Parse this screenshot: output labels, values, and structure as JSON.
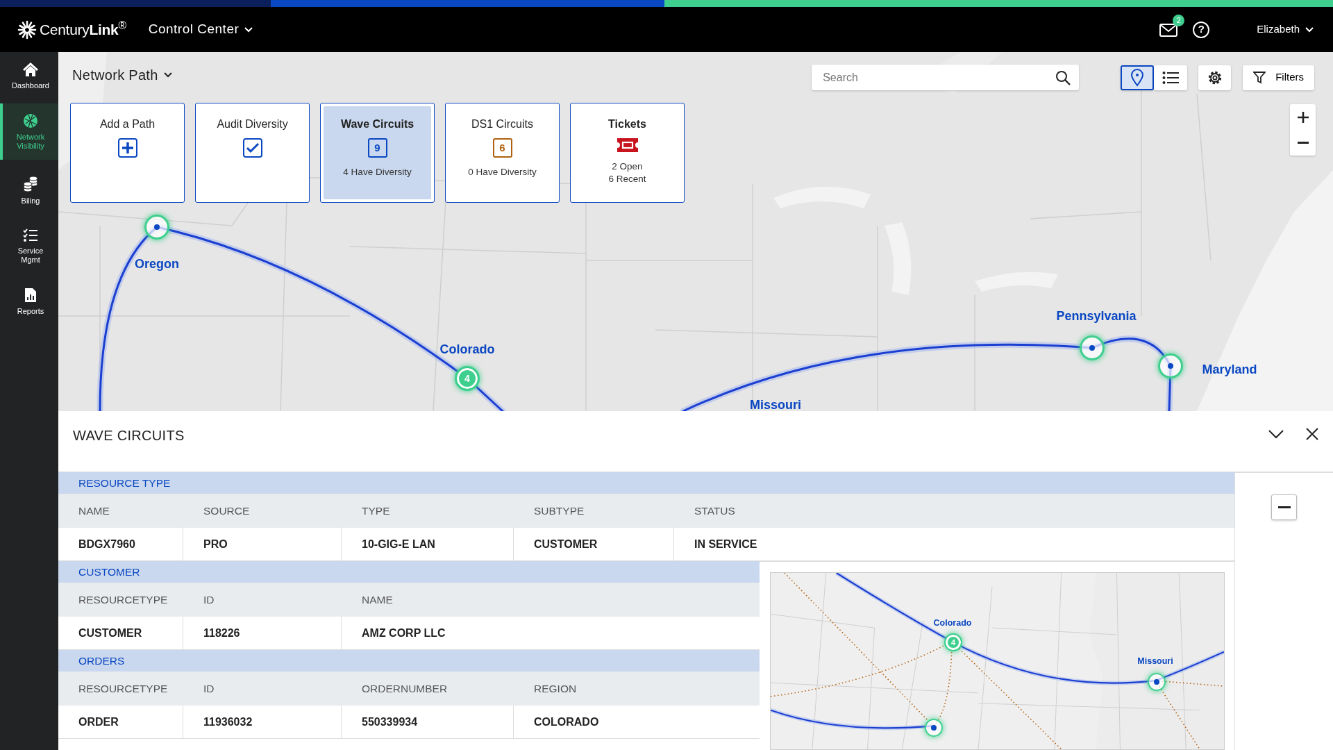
{
  "top_bar": {
    "brand": "Century**Link**$^{®}$",
    "app_menu": "Control Center",
    "help": "?",
    "notifications": "2",
    "user": "Elizabeth"
  },
  "sidebar": {
    "items": [
      {
        "label": "Dashboard",
        "kind": "home",
        "selected": false
      },
      {
        "label": "Network Visibility",
        "kind": "globe",
        "selected": true
      },
      {
        "label": "Biling",
        "kind": "coins",
        "selected": false
      },
      {
        "label": "Service Mgmt",
        "kind": "checklist",
        "selected": false
      },
      {
        "label": "Reports",
        "kind": "report",
        "selected": false
      }
    ]
  },
  "page_title": "Network Path",
  "search": {
    "placeholder": "Search"
  },
  "view_toggle": [
    {
      "kind": "map",
      "selected": true
    },
    {
      "kind": "list",
      "selected": false
    }
  ],
  "filters_button": "Filters",
  "tiles": [
    {
      "title": "Add a Path",
      "kind": "add",
      "selected": false
    },
    {
      "title": "Audit Diversity",
      "kind": "audit",
      "selected": false
    },
    {
      "title": "Wave Circuits",
      "kind": "count",
      "count": "9",
      "color": "#0a47c2",
      "selected": true,
      "lines": [
        "4 Have Diversity"
      ]
    },
    {
      "title": "DS1 Circuits",
      "kind": "count",
      "count": "6",
      "color": "#b0620f",
      "selected": false,
      "lines": [
        "0 Have Diversity"
      ]
    },
    {
      "title": "Tickets",
      "kind": "ticket",
      "selected": false,
      "lines": [
        "2 Open",
        "6 Recent"
      ]
    }
  ],
  "map": {
    "labels": [
      "Oregon",
      "Colorado",
      "Missouri",
      "Pennsylvania",
      "Maryland"
    ],
    "markers": [
      {
        "kind": "point"
      },
      {
        "kind": "cluster",
        "count": "4"
      },
      {
        "kind": "point"
      },
      {
        "kind": "point"
      }
    ]
  },
  "panel": {
    "title": "WAVE CIRCUITS",
    "sections": [
      {
        "title": "RESOURCE TYPE",
        "columns": [
          "NAME",
          "SOURCE",
          "TYPE",
          "SUBTYPE",
          "STATUS"
        ],
        "rows": [
          [
            "BDGX7960",
            "PRO",
            "10-GIG-E LAN",
            "CUSTOMER",
            "IN SERVICE"
          ]
        ]
      },
      {
        "title": "CUSTOMER",
        "columns": [
          "RESOURCETYPE",
          "ID",
          "NAME"
        ],
        "rows": [
          [
            "CUSTOMER",
            "118226",
            "AMZ CORP LLC"
          ]
        ]
      },
      {
        "title": "ORDERS",
        "columns": [
          "RESOURCETYPE",
          "ID",
          "ORDERNUMBER",
          "REGION"
        ],
        "rows": [
          [
            "ORDER",
            "11936032",
            "550339934",
            "COLORADO"
          ]
        ]
      }
    ],
    "minimap": {
      "labels": [
        "Colorado",
        "Missouri"
      ],
      "markers": [
        {
          "kind": "cluster",
          "count": "4"
        },
        {
          "kind": "point"
        },
        {
          "kind": "point"
        }
      ]
    }
  }
}
